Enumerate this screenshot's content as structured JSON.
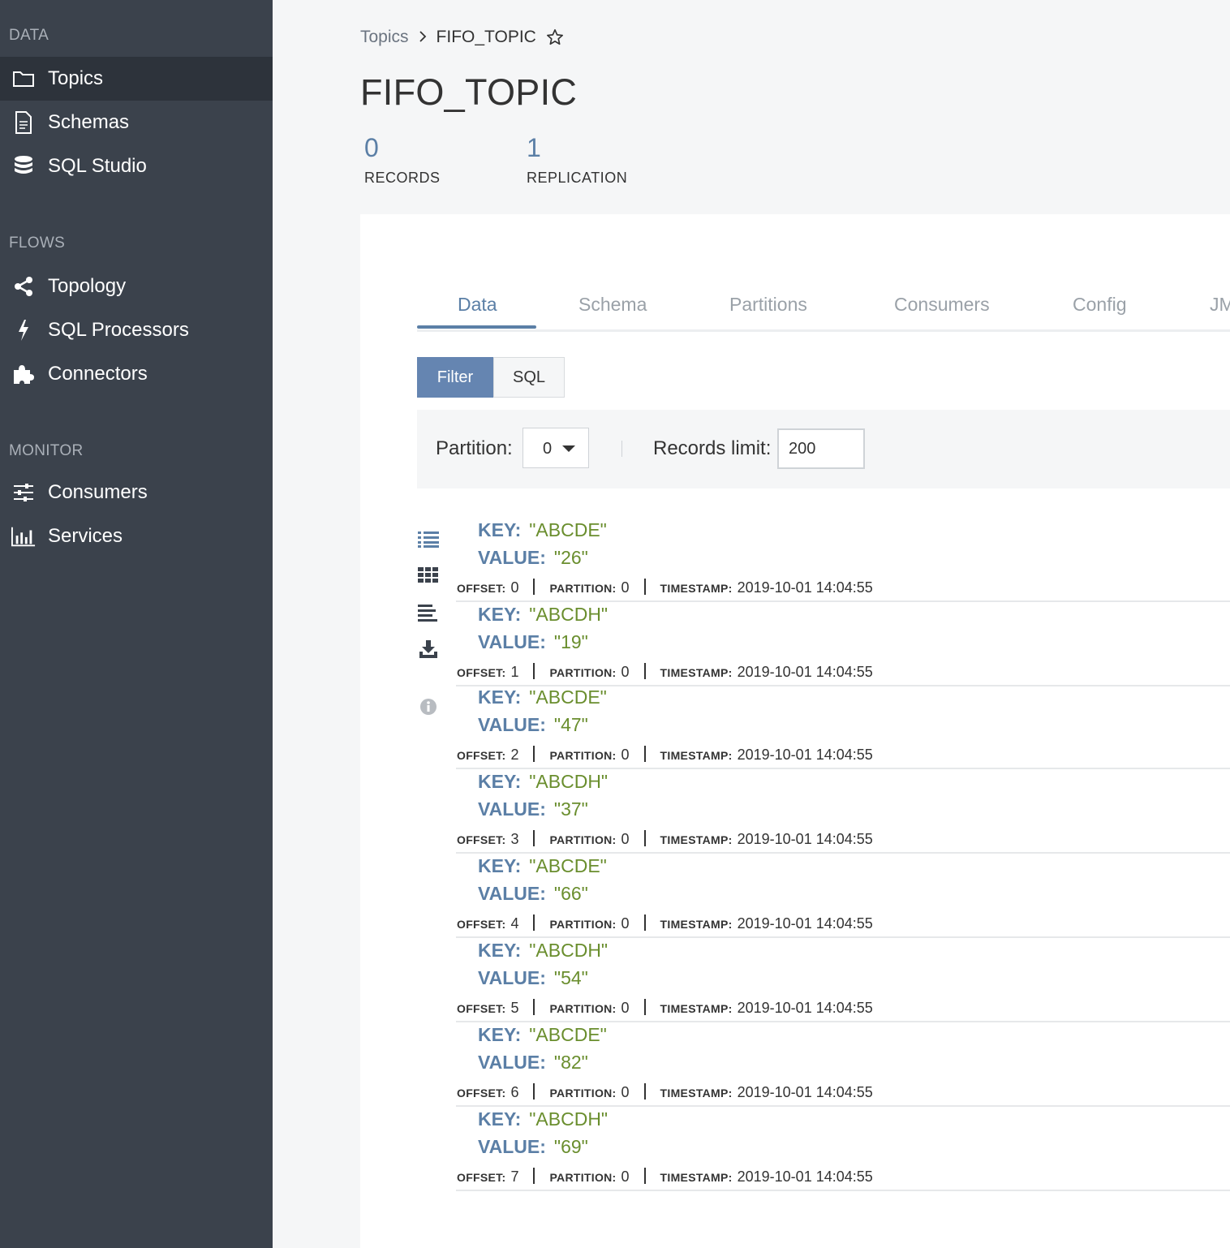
{
  "sidebar": {
    "sections": [
      {
        "title": "DATA",
        "items": [
          {
            "label": "Topics",
            "icon": "folder-icon",
            "active": true
          },
          {
            "label": "Schemas",
            "icon": "document-icon"
          },
          {
            "label": "SQL Studio",
            "icon": "database-icon"
          }
        ]
      },
      {
        "title": "FLOWS",
        "items": [
          {
            "label": "Topology",
            "icon": "share-icon"
          },
          {
            "label": "SQL Processors",
            "icon": "bolt-icon"
          },
          {
            "label": "Connectors",
            "icon": "puzzle-icon"
          }
        ]
      },
      {
        "title": "MONITOR",
        "items": [
          {
            "label": "Consumers",
            "icon": "sliders-icon"
          },
          {
            "label": "Services",
            "icon": "bar-chart-icon"
          }
        ]
      }
    ]
  },
  "breadcrumb": {
    "parent": "Topics",
    "separator": ">",
    "current": "FIFO_TOPIC"
  },
  "page": {
    "title": "FIFO_TOPIC"
  },
  "stats": {
    "records": {
      "value": "0",
      "label": "RECORDS"
    },
    "replication": {
      "value": "1",
      "label": "REPLICATION"
    }
  },
  "tabs": [
    "Data",
    "Schema",
    "Partitions",
    "Consumers",
    "Config",
    "JM"
  ],
  "active_tab": "Data",
  "mode": {
    "filter_label": "Filter",
    "sql_label": "SQL",
    "active": "Filter"
  },
  "filter_bar": {
    "partition_label": "Partition:",
    "partition_value": "0",
    "limit_label": "Records limit:",
    "limit_value": "200"
  },
  "tool_icons": [
    "list-icon",
    "grid-icon",
    "text-lines-icon",
    "download-icon",
    "info-icon"
  ],
  "labels": {
    "key": "KEY:",
    "value": "VALUE:",
    "offset": "OFFSET:",
    "partition": "PARTITION:",
    "timestamp": "TIMESTAMP:"
  },
  "records": [
    {
      "key": "\"ABCDE\"",
      "value": "\"26\"",
      "offset": "0",
      "partition": "0",
      "timestamp": "2019-10-01 14:04:55"
    },
    {
      "key": "\"ABCDH\"",
      "value": "\"19\"",
      "offset": "1",
      "partition": "0",
      "timestamp": "2019-10-01 14:04:55"
    },
    {
      "key": "\"ABCDE\"",
      "value": "\"47\"",
      "offset": "2",
      "partition": "0",
      "timestamp": "2019-10-01 14:04:55"
    },
    {
      "key": "\"ABCDH\"",
      "value": "\"37\"",
      "offset": "3",
      "partition": "0",
      "timestamp": "2019-10-01 14:04:55"
    },
    {
      "key": "\"ABCDE\"",
      "value": "\"66\"",
      "offset": "4",
      "partition": "0",
      "timestamp": "2019-10-01 14:04:55"
    },
    {
      "key": "\"ABCDH\"",
      "value": "\"54\"",
      "offset": "5",
      "partition": "0",
      "timestamp": "2019-10-01 14:04:55"
    },
    {
      "key": "\"ABCDE\"",
      "value": "\"82\"",
      "offset": "6",
      "partition": "0",
      "timestamp": "2019-10-01 14:04:55"
    },
    {
      "key": "\"ABCDH\"",
      "value": "\"69\"",
      "offset": "7",
      "partition": "0",
      "timestamp": "2019-10-01 14:04:55"
    }
  ],
  "colors": {
    "sidebar_bg": "#3b424c",
    "sidebar_active": "#2d333b",
    "accent": "#5b7fa6",
    "key_value_text": "#6a8e2e",
    "filter_button": "#6585b1"
  }
}
